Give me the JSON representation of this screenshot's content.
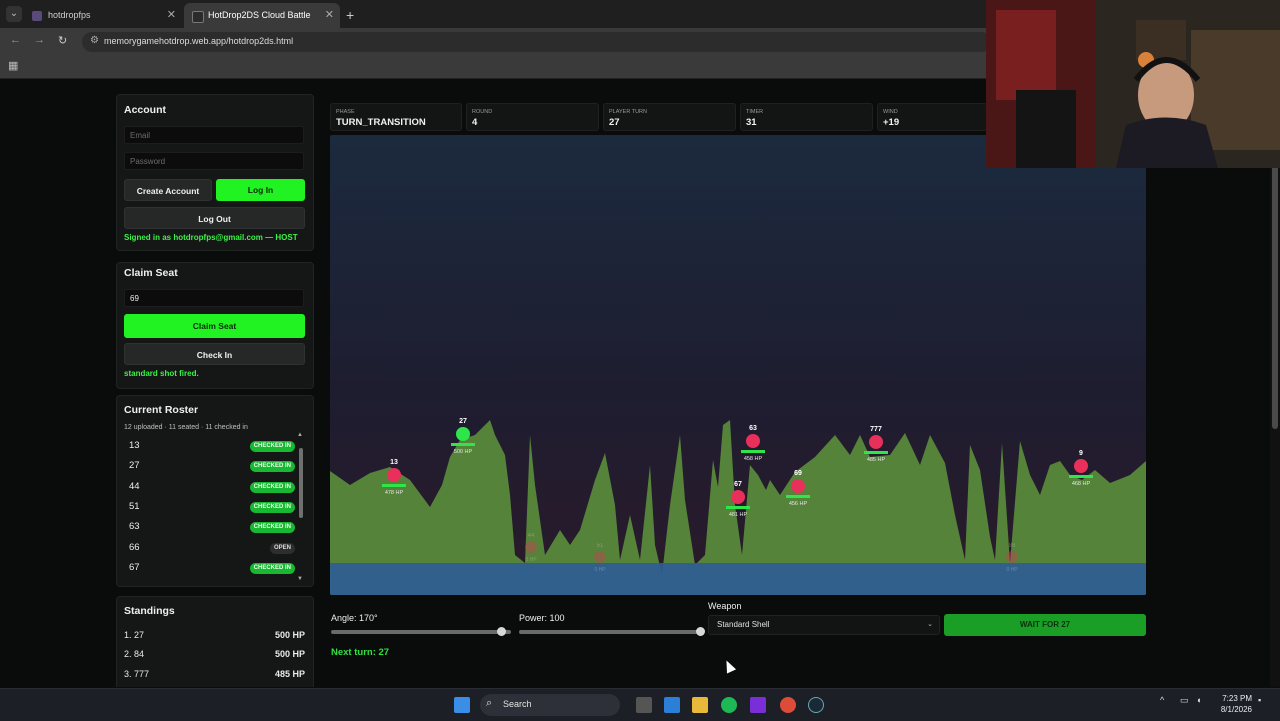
{
  "browser": {
    "tabs": [
      {
        "title": "hotdropfps"
      },
      {
        "title": "HotDrop2DS Cloud Battle"
      }
    ],
    "new_tab": "+",
    "url": "memorygamehotdrop.web.app/hotdrop2ds.html",
    "nav_icons": {
      "back": "arrow-left-icon",
      "forward": "arrow-right-icon",
      "reload": "reload-icon"
    }
  },
  "account": {
    "heading": "Account",
    "email_placeholder": "Email",
    "password_placeholder": "Password",
    "create_label": "Create Account",
    "login_label": "Log In",
    "logout_label": "Log Out",
    "status": "Signed in as hotdropfps@gmail.com — HOST"
  },
  "seat": {
    "heading": "Claim Seat",
    "seat_value": "69",
    "claim_label": "Claim Seat",
    "checkin_label": "Check In",
    "status": "standard shot fired."
  },
  "roster": {
    "heading": "Current Roster",
    "summary": "12 uploaded · 11 seated · 11 checked in",
    "rows": [
      {
        "num": "13",
        "status": "CHECKED IN",
        "kind": "in"
      },
      {
        "num": "27",
        "status": "CHECKED IN",
        "kind": "in"
      },
      {
        "num": "44",
        "status": "CHECKED IN",
        "kind": "in"
      },
      {
        "num": "51",
        "status": "CHECKED IN",
        "kind": "in"
      },
      {
        "num": "63",
        "status": "CHECKED IN",
        "kind": "in"
      },
      {
        "num": "66",
        "status": "OPEN",
        "kind": "open"
      },
      {
        "num": "67",
        "status": "CHECKED IN",
        "kind": "in"
      }
    ]
  },
  "standings": {
    "heading": "Standings",
    "rows": [
      {
        "rank": "1. 27",
        "hp": "500 HP"
      },
      {
        "rank": "2. 84",
        "hp": "500 HP"
      },
      {
        "rank": "3. 777",
        "hp": "485 HP"
      }
    ]
  },
  "stats": [
    {
      "label": "PHASE",
      "value": "TURN_TRANSITION"
    },
    {
      "label": "ROUND",
      "value": "4"
    },
    {
      "label": "PLAYER TURN",
      "value": "27"
    },
    {
      "label": "TIMER",
      "value": "31"
    },
    {
      "label": "WIND",
      "value": "+19"
    }
  ],
  "players": [
    {
      "num": "13",
      "hp_text": "478 HP",
      "color": "#e8305a"
    },
    {
      "num": "27",
      "hp_text": "500 HP",
      "color": "#2ee64a"
    },
    {
      "num": "63",
      "hp_text": "458 HP",
      "color": "#e8305a"
    },
    {
      "num": "67",
      "hp_text": "481 HP",
      "color": "#e8305a"
    },
    {
      "num": "69",
      "hp_text": "456 HP",
      "color": "#e8305a"
    },
    {
      "num": "777",
      "hp_text": "485 HP",
      "color": "#e8305a"
    },
    {
      "num": "9",
      "hp_text": "468 HP",
      "color": "#e8305a"
    }
  ],
  "dead_players": [
    {
      "num": "44",
      "hp_text": "0 HP"
    },
    {
      "num": "51",
      "hp_text": "0 HP"
    },
    {
      "num": "88",
      "hp_text": "0 HP"
    }
  ],
  "controls": {
    "angle_label": "Angle: 170°",
    "angle_value": 170,
    "power_label": "Power: 100",
    "power_value": 100,
    "weapon_heading": "Weapon",
    "weapon_selected": "Standard Shell",
    "action_label": "WAIT FOR 27",
    "next_turn": "Next turn: 27"
  },
  "taskbar": {
    "search_label": "Search",
    "time": "7:23 PM",
    "date": "8/1/2026"
  },
  "colors": {
    "accent_green": "#21f221",
    "enemy": "#e8305a",
    "terrain": "#55833a",
    "water": "#2f5d95"
  }
}
